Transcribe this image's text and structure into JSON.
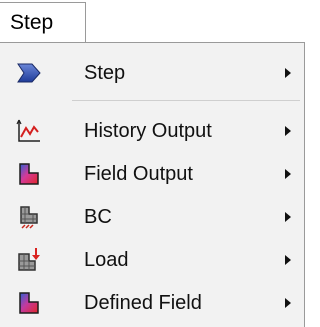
{
  "menu": {
    "tab_label": "Step",
    "items": [
      {
        "label": "Step",
        "icon": "step-arrow-icon"
      },
      {
        "label": "History Output",
        "icon": "history-output-icon"
      },
      {
        "label": "Field Output",
        "icon": "field-output-icon"
      },
      {
        "label": "BC",
        "icon": "bc-icon"
      },
      {
        "label": "Load",
        "icon": "load-icon"
      },
      {
        "label": "Defined Field",
        "icon": "defined-field-icon"
      }
    ]
  }
}
